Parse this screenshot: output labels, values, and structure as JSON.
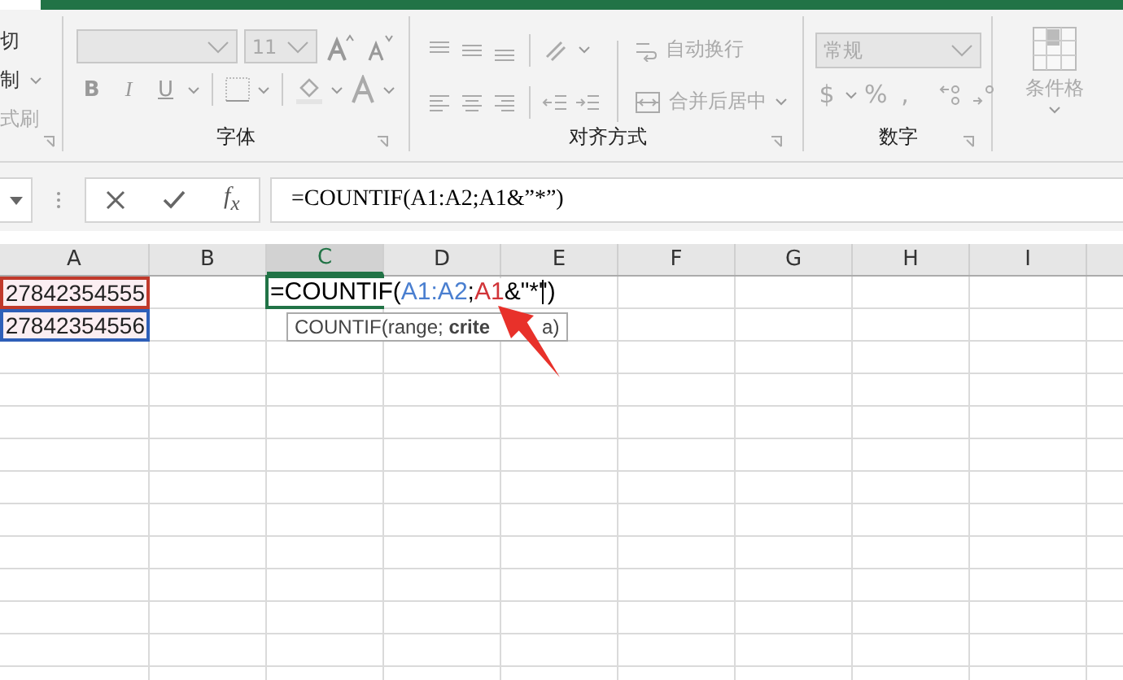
{
  "ribbon": {
    "clipboard": {
      "items": [
        {
          "label": "切",
          "caret": false
        },
        {
          "label": "制",
          "caret": true
        },
        {
          "label": "式刷",
          "caret": false
        }
      ]
    },
    "font": {
      "font_size": {
        "value": "11"
      },
      "buttons": [
        "B",
        "I",
        "U"
      ],
      "label": "字体"
    },
    "alignment": {
      "wrap": "自动换行",
      "merge": "合并后居中",
      "label": "对齐方式"
    },
    "number": {
      "format": {
        "value": "常规"
      },
      "buttons": [
        "$",
        "%",
        ","
      ],
      "label": "数字"
    },
    "styles": {
      "conditional": "条件格"
    }
  },
  "formula_bar": {
    "fx": "f$_{x}$",
    "formula": "=COUNTIF(A1:A2;A1&”*”)"
  },
  "sheet": {
    "columns": [
      {
        "label": "A",
        "selected": false
      },
      {
        "label": "B",
        "selected": false
      },
      {
        "label": "C",
        "selected": true
      },
      {
        "label": "D",
        "selected": false
      },
      {
        "label": "E",
        "selected": false
      },
      {
        "label": "F",
        "selected": false
      },
      {
        "label": "G",
        "selected": false
      },
      {
        "label": "H",
        "selected": false
      },
      {
        "label": "I",
        "selected": false
      }
    ],
    "rows": [
      {
        "col_a": {
          "text": "27842354555",
          "color": "#c0392b"
        },
        "col_c": {
          "segments": [
            {
              "text": "=COUNTIF(",
              "color": "#000000"
            },
            {
              "text": "A1:A2",
              "color": "#4a7fd0"
            },
            {
              "text": ";",
              "color": "#000000"
            },
            {
              "text": "A1",
              "color": "#d13438"
            },
            {
              "text": "&\"*\")",
              "color": "#000000"
            }
          ]
        }
      },
      {
        "col_a": {
          "text": "27842354556",
          "color": "#2e5fb8"
        }
      }
    ],
    "tooltip": {
      "start": "COUNTIF(range; **crite**",
      "end": "a)"
    }
  }
}
